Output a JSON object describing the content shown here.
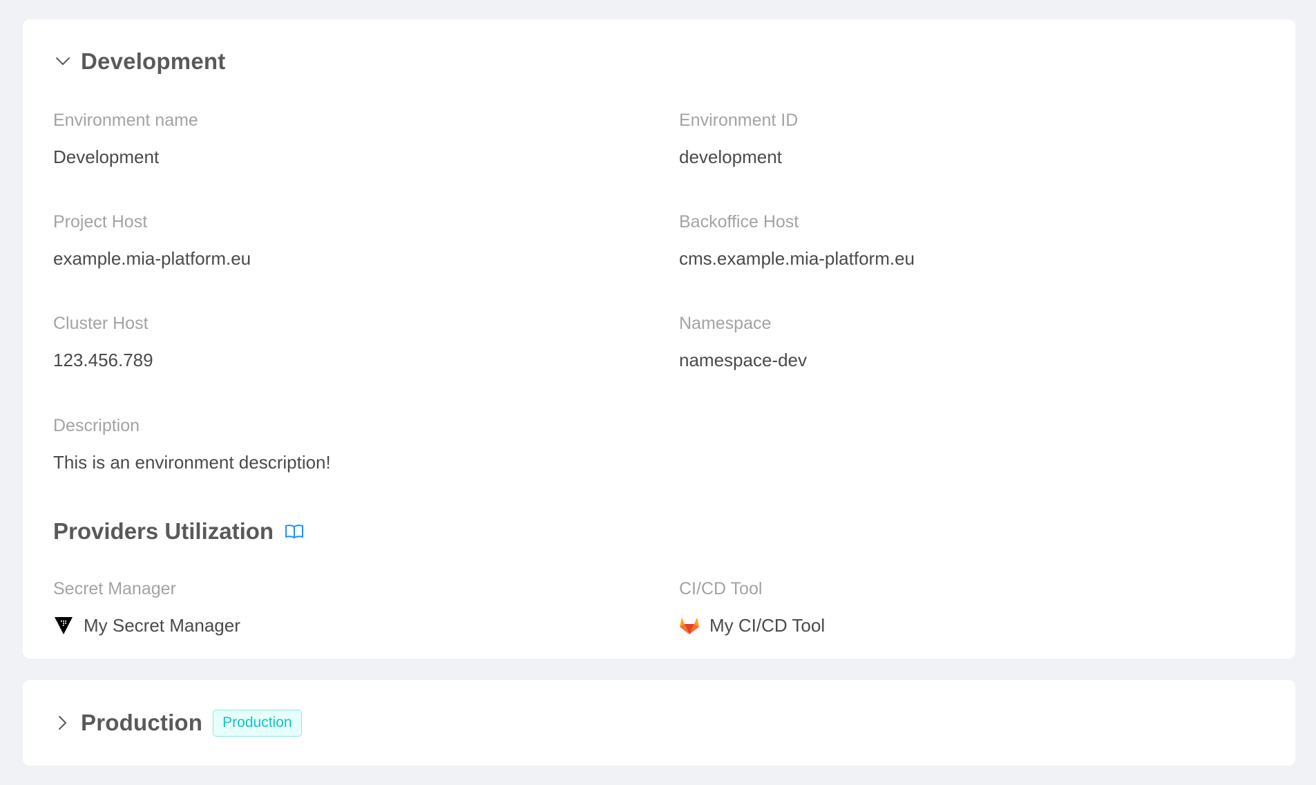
{
  "environments": [
    {
      "title": "Development",
      "expanded": true,
      "fields": {
        "env_name_label": "Environment name",
        "env_name_value": "Development",
        "env_id_label": "Environment ID",
        "env_id_value": "development",
        "project_host_label": "Project Host",
        "project_host_value": "example.mia-platform.eu",
        "backoffice_host_label": "Backoffice Host",
        "backoffice_host_value": "cms.example.mia-platform.eu",
        "cluster_host_label": "Cluster Host",
        "cluster_host_value": "123.456.789",
        "namespace_label": "Namespace",
        "namespace_value": "namespace-dev",
        "description_label": "Description",
        "description_value": "This is an environment description!"
      },
      "providers": {
        "title": "Providers Utilization",
        "title_icon": "book-icon",
        "secret_manager_label": "Secret Manager",
        "secret_manager_value": "My Secret Manager",
        "secret_manager_icon": "vault-icon",
        "cicd_label": "CI/CD Tool",
        "cicd_value": "My CI/CD Tool",
        "cicd_icon": "gitlab-icon"
      }
    },
    {
      "title": "Production",
      "expanded": false,
      "badge": "Production"
    }
  ],
  "colors": {
    "badge_text": "#13c2c2",
    "badge_bg": "#e6fffb",
    "badge_border": "#87e8de",
    "link_icon": "#1890ff",
    "gitlab_orange": "#e24329"
  }
}
